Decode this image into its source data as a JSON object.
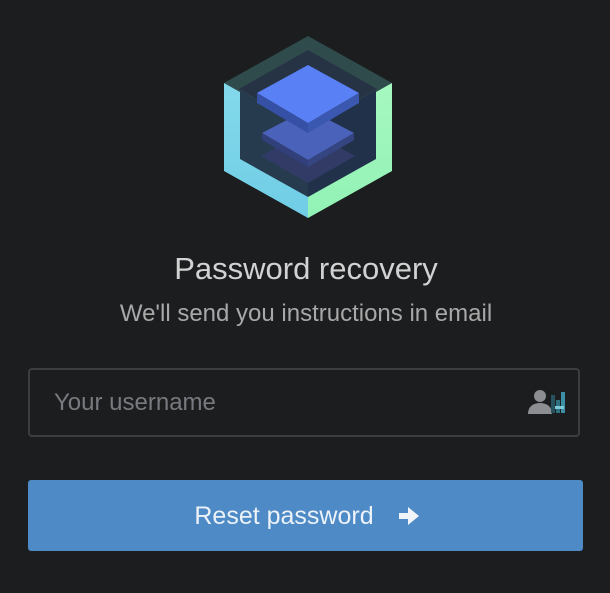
{
  "recovery": {
    "title": "Password recovery",
    "subtitle": "We'll send you instructions in email",
    "username": {
      "value": "",
      "placeholder": "Your username"
    },
    "reset_label": "Reset password"
  },
  "icons": {
    "logo": "cube-logo-icon",
    "username": "user-icon",
    "submit": "arrow-right-icon"
  },
  "colors": {
    "background": "#1c1d1f",
    "button": "#4d8ac6",
    "logo_left": "#7fd6e6",
    "logo_right": "#9bf4b8",
    "logo_top": "#5a7ff4"
  }
}
